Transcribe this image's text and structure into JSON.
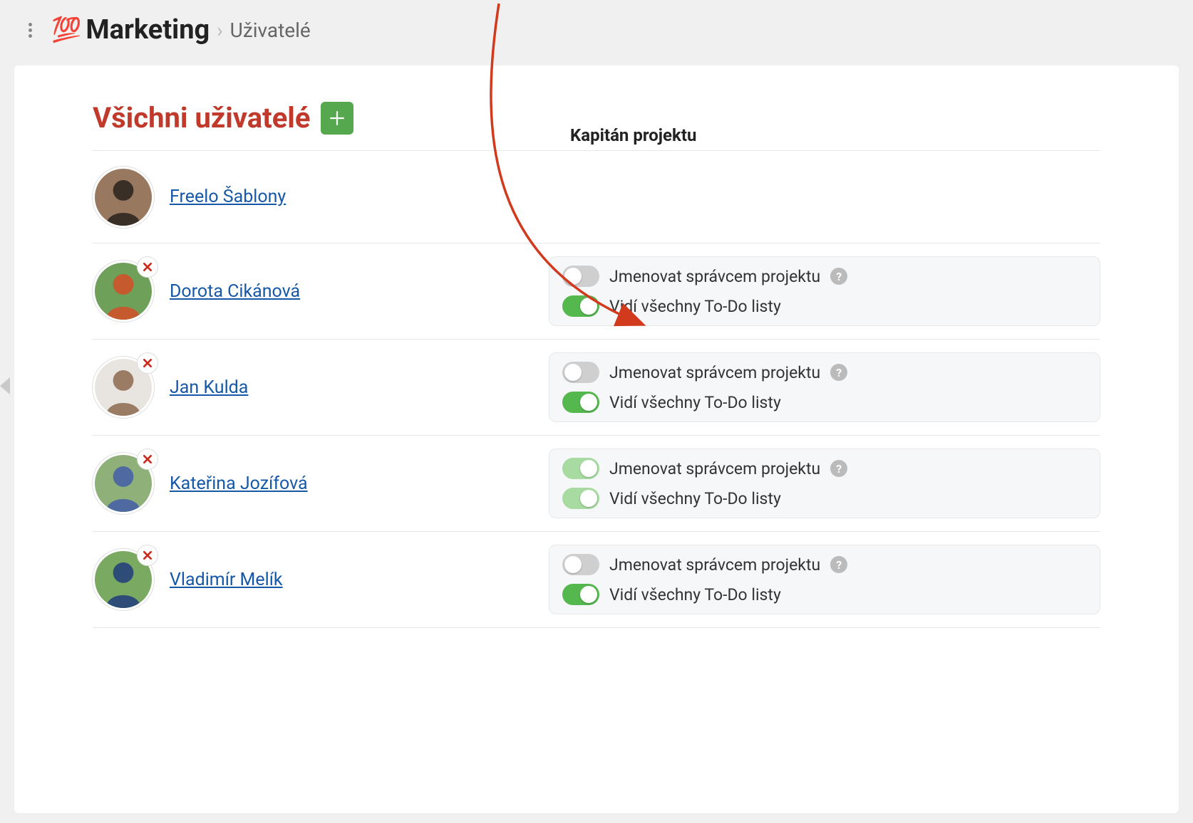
{
  "header": {
    "emoji": "💯",
    "project_title": "Marketing",
    "crumb_separator": "›",
    "crumb_page": "Uživatelé"
  },
  "page": {
    "title": "Všichni uživatelé",
    "column_header": "Kapitán projektu"
  },
  "perm_labels": {
    "admin": "Jmenovat správcem projektu",
    "sees_all": "Vidí všechny To-Do listy"
  },
  "users": [
    {
      "name": "Freelo Šablony",
      "removable": false,
      "avatar_bg": "#98785e",
      "avatar_fg": "#3a2f26",
      "admin_toggle": null,
      "sees_all_toggle": null
    },
    {
      "name": "Dorota Cikánová",
      "removable": true,
      "avatar_bg": "#6ea05a",
      "avatar_fg": "#c45a2e",
      "admin_toggle": "off",
      "sees_all_toggle": "on"
    },
    {
      "name": "Jan Kulda",
      "removable": true,
      "avatar_bg": "#e8e4e0",
      "avatar_fg": "#9a7b64",
      "admin_toggle": "off",
      "sees_all_toggle": "on"
    },
    {
      "name": "Kateřina Jozífová",
      "removable": true,
      "avatar_bg": "#8fb079",
      "avatar_fg": "#4e6aa0",
      "admin_toggle": "on-light",
      "sees_all_toggle": "on-light"
    },
    {
      "name": "Vladimír Melík",
      "removable": true,
      "avatar_bg": "#7aa962",
      "avatar_fg": "#2e4c78",
      "admin_toggle": "off",
      "sees_all_toggle": "on"
    }
  ]
}
